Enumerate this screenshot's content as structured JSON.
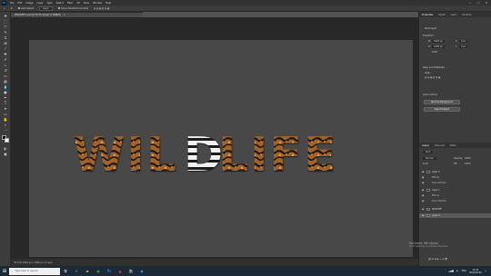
{
  "menubar": {
    "logo": "Ps",
    "items": [
      "File",
      "Edit",
      "Image",
      "Layer",
      "Type",
      "Select",
      "Filter",
      "3D",
      "View",
      "Window",
      "Help"
    ],
    "controls": [
      "—",
      "□",
      "✕"
    ]
  },
  "options": {
    "auto_select": "Auto-Select",
    "auto_select_value": "Layer",
    "show_transform": "Show Transform Controls"
  },
  "document": {
    "tab_title": "WILDLIFE 1.psd @ 33.3% (Layer 0, RGB/8)",
    "close": "✕",
    "canvas_text": "WILDLIFE",
    "status": "33.33%   1920 px x 1080 px (72 ppi)"
  },
  "properties": {
    "tabs": [
      "Properties",
      "Adjust",
      "Learn",
      "Libraries"
    ],
    "pixel_layer": "Pixel Layer",
    "transform_header": "Transform",
    "w_label": "W",
    "w_value": "1920 px",
    "h_label": "H",
    "h_value": "1080 px",
    "x_label": "X",
    "x_value": "0 px",
    "y_label": "Y",
    "y_value": "0 px",
    "angle": "0.00°",
    "align_header": "Align and Distribute",
    "align_sub": "Align:",
    "quick_actions_header": "Quick Actions",
    "remove_bg": "Remove Background",
    "select_subject": "Select Subject"
  },
  "layers": {
    "tabs": [
      "Layers",
      "Channels",
      "Paths"
    ],
    "kind": "Kind",
    "blend_mode": "Normal",
    "opacity_label": "Opacity:",
    "opacity_value": "100%",
    "lock_label": "Lock:",
    "fill_label": "Fill:",
    "fill_value": "100%",
    "rows": [
      {
        "name": "Layer 2",
        "type": "layer"
      },
      {
        "name": "Effects",
        "type": "sub"
      },
      {
        "name": "Drop Shadow",
        "type": "sub"
      },
      {
        "name": "Layer 1",
        "type": "layer"
      },
      {
        "name": "Effects",
        "type": "sub"
      },
      {
        "name": "Drop Shadow",
        "type": "sub"
      },
      {
        "name": "WILDLIFE",
        "type": "layer"
      },
      {
        "name": "Layer 0",
        "type": "layer"
      }
    ]
  },
  "activate_windows": {
    "title": "Activate Windows",
    "subtitle": "Go to Settings to activate Windows."
  },
  "taskbar": {
    "search_placeholder": "Type here to search",
    "lang": "ENG",
    "time": "10:44",
    "date": "05/08/2020"
  },
  "colors": {
    "canvas_bg": "#484848",
    "workspace_bg": "#282828",
    "panel_bg": "#3c3c3c",
    "fur_brown": "#a2642b",
    "fur_dark": "#1c140c",
    "zebra_white": "#f0f0f0"
  }
}
